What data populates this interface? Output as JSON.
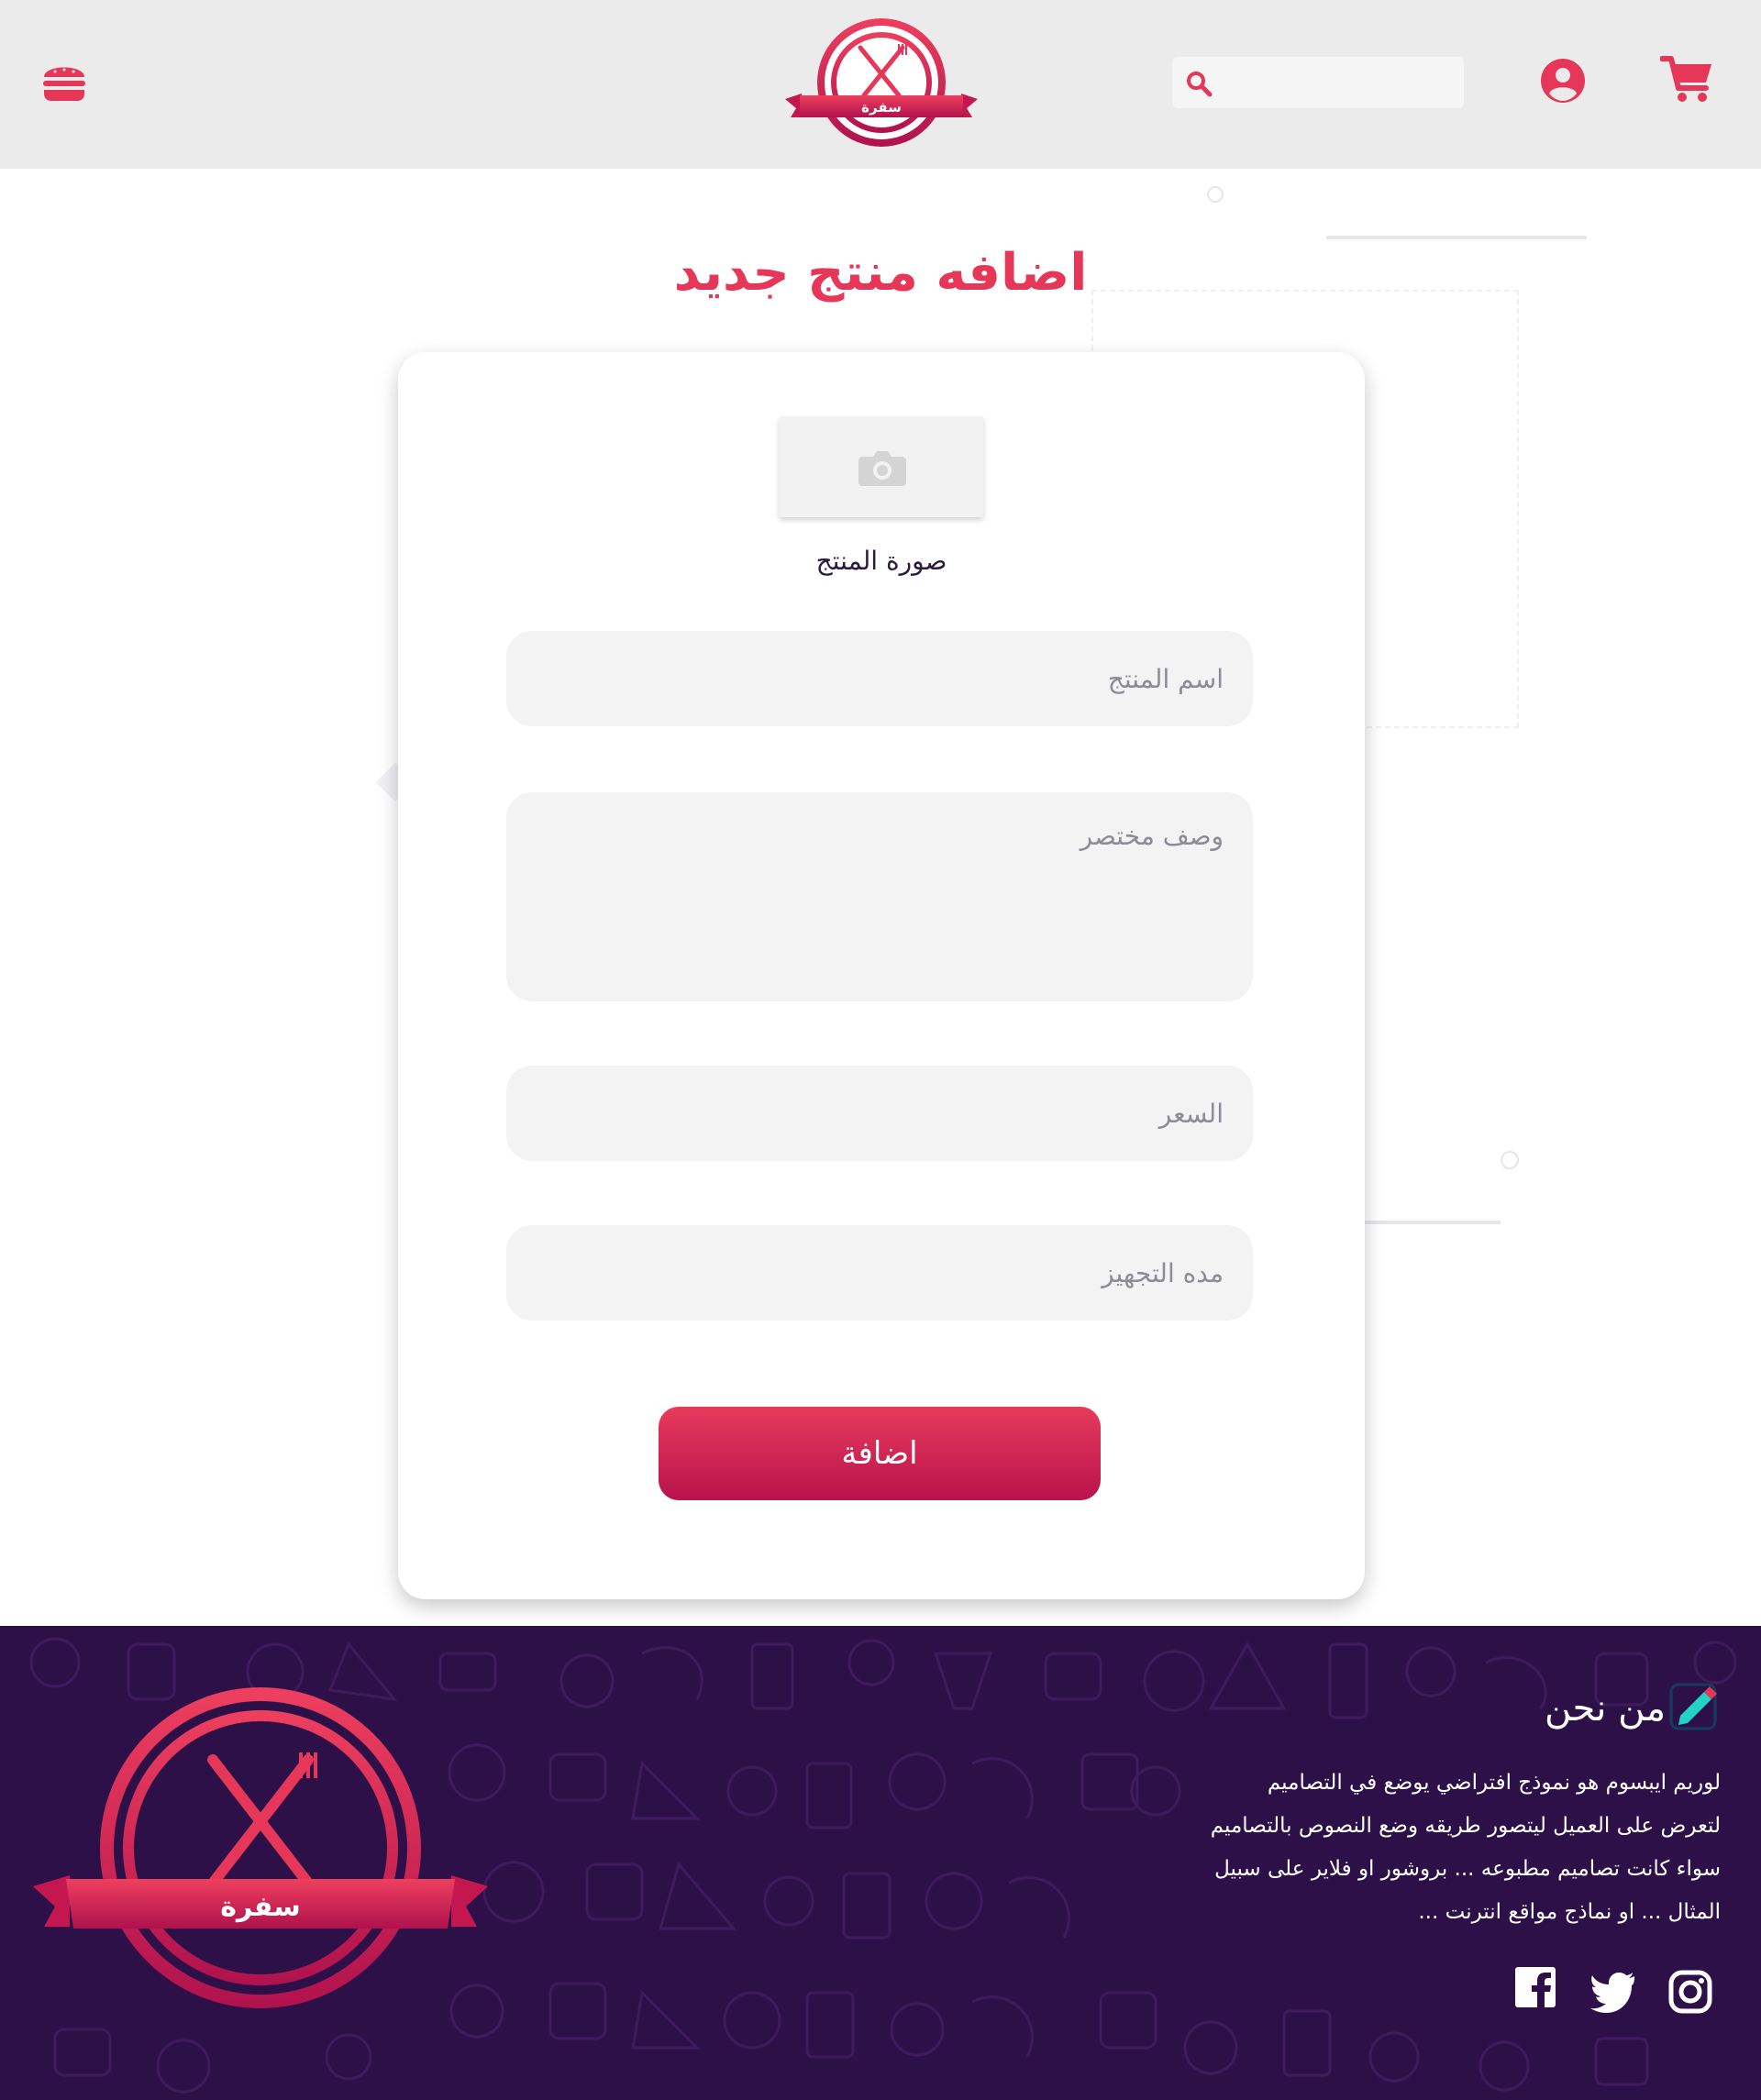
{
  "header": {
    "logo_text": "سفرة",
    "search_placeholder": ""
  },
  "page": {
    "title": "اضافه منتج جديد"
  },
  "form": {
    "image_label": "صورة المنتج",
    "name_placeholder": "اسم المنتج",
    "description_placeholder": "وصف مختصر",
    "price_placeholder": "السعر",
    "prep_time_placeholder": "مده التجهيز",
    "submit_label": "اضافة"
  },
  "footer": {
    "logo_text": "سفرة",
    "about_title": "من نحن",
    "about_lines": [
      "لوريم ايبسوم هو نموذج افتراضي يوضع في التصاميم",
      "لتعرض على العميل ليتصور طريقه وضع النصوص بالتصاميم",
      "سواء كانت تصاميم مطبوعه ... بروشور او فلاير على سبيل",
      "المثال ... او نماذج مواقع انترنت ..."
    ]
  },
  "colors": {
    "accent": "#e63758",
    "accent_dark": "#b8134d",
    "header_bg": "#ebebeb",
    "footer_bg": "#2e1048",
    "field_bg": "#f3f3f3"
  },
  "icons": {
    "menu": "burger-icon",
    "search": "search-icon",
    "user": "user-circle-icon",
    "cart": "cart-icon",
    "upload": "camera-icon",
    "about": "pencil-icon",
    "social": [
      "instagram-icon",
      "twitter-icon",
      "facebook-icon"
    ]
  }
}
